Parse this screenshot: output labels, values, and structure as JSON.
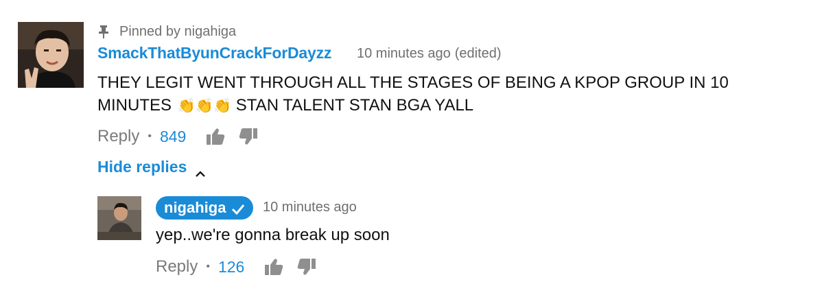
{
  "top_comment": {
    "pinned_text": "Pinned by nigahiga",
    "author": "SmackThatByunCrackForDayzz",
    "timestamp": "10 minutes ago",
    "edited": "(edited)",
    "text_line1": "THEY LEGIT WENT THROUGH ALL THE STAGES OF BEING A KPOP GROUP IN 10",
    "text_line2_start": "MINUTES",
    "text_line2_emoji": "👏👏👏",
    "text_line2_end": "STAN TALENT STAN BGA YALL",
    "reply_label": "Reply",
    "separator": "•",
    "like_count": "849",
    "hide_replies_label": "Hide replies"
  },
  "reply": {
    "author": "nigahiga",
    "timestamp": "10 minutes ago",
    "text": "yep..we're gonna break up soon",
    "reply_label": "Reply",
    "separator": "•",
    "like_count": "126"
  },
  "icons": {
    "pin": "pin-icon",
    "like": "thumbs-up-icon",
    "dislike": "thumbs-down-icon",
    "chevron": "chevron-up-icon",
    "verified": "checkmark-icon"
  },
  "colors": {
    "accent": "#1a8bd7",
    "muted": "#6f6f6f",
    "icon_gray": "#8f8f8f"
  }
}
